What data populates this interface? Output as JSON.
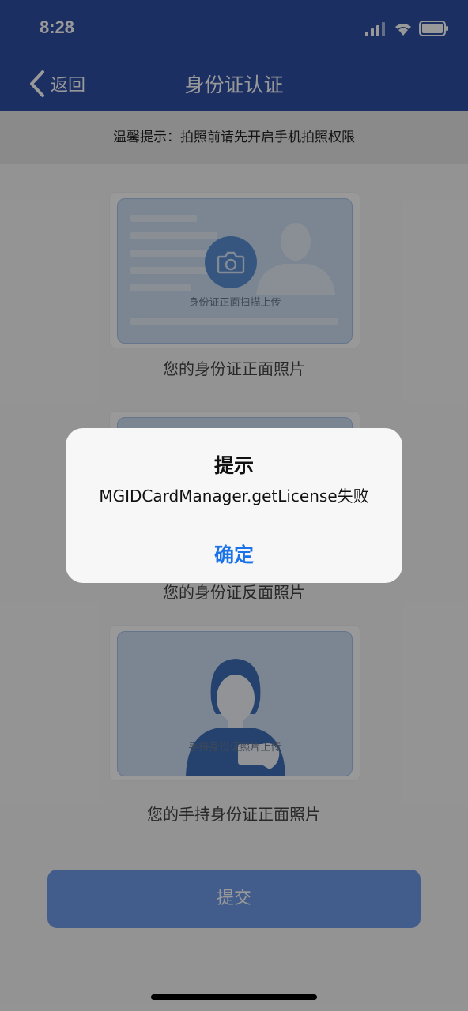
{
  "status_bar": {
    "time": "8:28"
  },
  "nav": {
    "back_label": "返回",
    "title": "身份证认证"
  },
  "tip": "温馨提示：拍照前请先开启手机拍照权限",
  "cards": [
    {
      "inner_label": "身份证正面扫描上传",
      "caption": "您的身份证正面照片"
    },
    {
      "caption": "您的身份证反面照片"
    },
    {
      "inner_label": "手持身份证照片上传",
      "caption": "您的手持身份证正面照片"
    }
  ],
  "submit_label": "提交",
  "alert": {
    "title": "提示",
    "message": "MGIDCardManager.getLicense失败",
    "confirm_label": "确定"
  },
  "colors": {
    "nav_blue": "#2d4fa6",
    "submit_blue": "#6f9bea",
    "alert_button": "#1a73e8"
  }
}
